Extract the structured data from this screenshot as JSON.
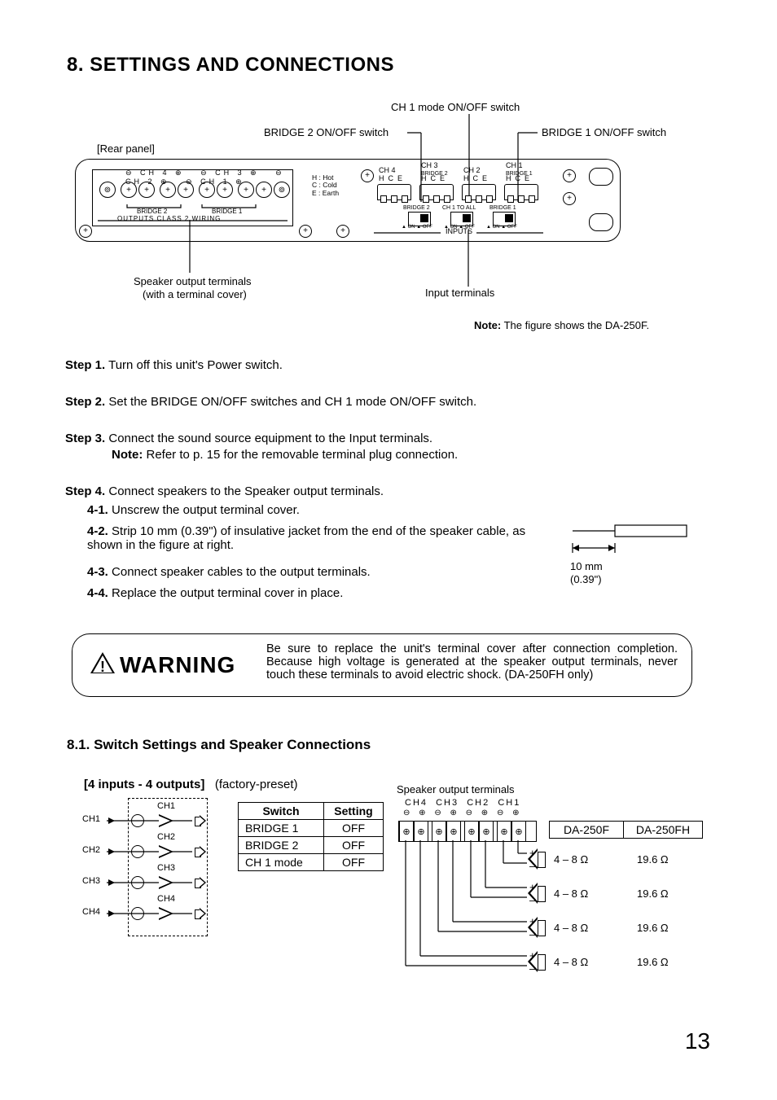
{
  "section_heading": "8. SETTINGS AND CONNECTIONS",
  "rear_panel": {
    "title": "[Rear panel]",
    "callouts": {
      "ch1_mode": "CH 1 mode ON/OFF switch",
      "bridge2": "BRIDGE 2 ON/OFF switch",
      "bridge1": "BRIDGE 1 ON/OFF switch",
      "spk_out_line1": "Speaker output terminals",
      "spk_out_line2": "(with a terminal cover)",
      "inputs": "Input terminals"
    },
    "legend": {
      "H": "H : Hot",
      "C": "C : Cold",
      "E": "E : Earth"
    },
    "output_ch_labels": [
      "CH 4",
      "CH 3",
      "CH 2",
      "CH 1"
    ],
    "output_polarity": [
      "⊖",
      "⊕",
      "⊖",
      "⊕",
      "⊖",
      "⊕",
      "⊖",
      "⊕"
    ],
    "bridge_under": [
      "BRIDGE 2",
      "BRIDGE 1"
    ],
    "left_label": "OUTPUTS  CLASS 2 WIRING",
    "input_blocks": [
      {
        "name": "CH 4",
        "sub": "",
        "pins": "H  C  E"
      },
      {
        "name": "CH 3",
        "sub": "BRIDGE 2",
        "pins": "H  C  E"
      },
      {
        "name": "CH 2",
        "sub": "",
        "pins": "H  C  E"
      },
      {
        "name": "CH 1",
        "sub": "BRIDGE 1",
        "pins": "H  C  E"
      }
    ],
    "dip_labels": [
      "BRIDGE 2",
      "CH 1 TO ALL",
      "BRIDGE 1"
    ],
    "dip_on": "ON",
    "dip_off": "OFF",
    "inputs_label": "INPUTS"
  },
  "note_figure": {
    "note_label": "Note:",
    "text": "The figure shows the DA-250F."
  },
  "steps": [
    {
      "label": "Step 1.",
      "text": "Turn off this unit's Power switch."
    },
    {
      "label": "Step 2.",
      "text": "Set the BRIDGE ON/OFF switches and CH 1 mode ON/OFF switch."
    },
    {
      "label": "Step 3.",
      "text": "Connect the sound source equipment to the Input terminals.",
      "note_label": "Note:",
      "note_text": "Refer to p. 15 for the removable terminal plug connection."
    },
    {
      "label": "Step 4.",
      "text": "Connect speakers to the Speaker output terminals."
    }
  ],
  "substeps": [
    {
      "label": "4-1.",
      "text": "Unscrew the output terminal cover."
    },
    {
      "label": "4-2.",
      "text": "Strip 10 mm (0.39\") of insulative jacket from the end of the speaker cable, as shown in the figure at right."
    },
    {
      "label": "4-3.",
      "text": "Connect speaker cables to the output terminals."
    },
    {
      "label": "4-4.",
      "text": "Replace the output terminal cover in place."
    }
  ],
  "strip_fig": {
    "len": "10 mm",
    "len2": "(0.39\")"
  },
  "warning": {
    "title": "WARNING",
    "body": "Be sure to replace the unit's terminal cover after connection completion. Because high voltage is generated at the speaker output terminals, never touch these terminals to avoid electric shock. (DA-250FH only)"
  },
  "subsection_heading": "8.1. Switch Settings and Speaker Connections",
  "config": {
    "title": "[4 inputs - 4 outputs]",
    "preset": "(factory-preset)",
    "signal_rows": [
      "CH1",
      "CH2",
      "CH3",
      "CH4"
    ],
    "amp_rows": [
      "CH1",
      "CH2",
      "CH3",
      "CH4"
    ],
    "switch_table": {
      "headers": [
        "Switch",
        "Setting"
      ],
      "rows": [
        [
          "BRIDGE 1",
          "OFF"
        ],
        [
          "BRIDGE 2",
          "OFF"
        ],
        [
          "CH 1 mode",
          "OFF"
        ]
      ]
    },
    "spk_term_title": "Speaker output terminals",
    "spk_term_cols": [
      "CH4",
      "CH3",
      "CH2",
      "CH1"
    ],
    "spk_term_polarity": [
      "⊖",
      "⊕",
      "⊖",
      "⊕",
      "⊖",
      "⊕",
      "⊖",
      "⊕"
    ],
    "imp_headers": [
      "DA-250F",
      "DA-250FH"
    ],
    "imp_rows": [
      [
        "4 – 8 Ω",
        "19.6 Ω"
      ],
      [
        "4 – 8 Ω",
        "19.6 Ω"
      ],
      [
        "4 – 8 Ω",
        "19.6 Ω"
      ],
      [
        "4 – 8 Ω",
        "19.6 Ω"
      ]
    ],
    "polarity_plus": "+",
    "polarity_minus": "–"
  },
  "page_number": "13"
}
